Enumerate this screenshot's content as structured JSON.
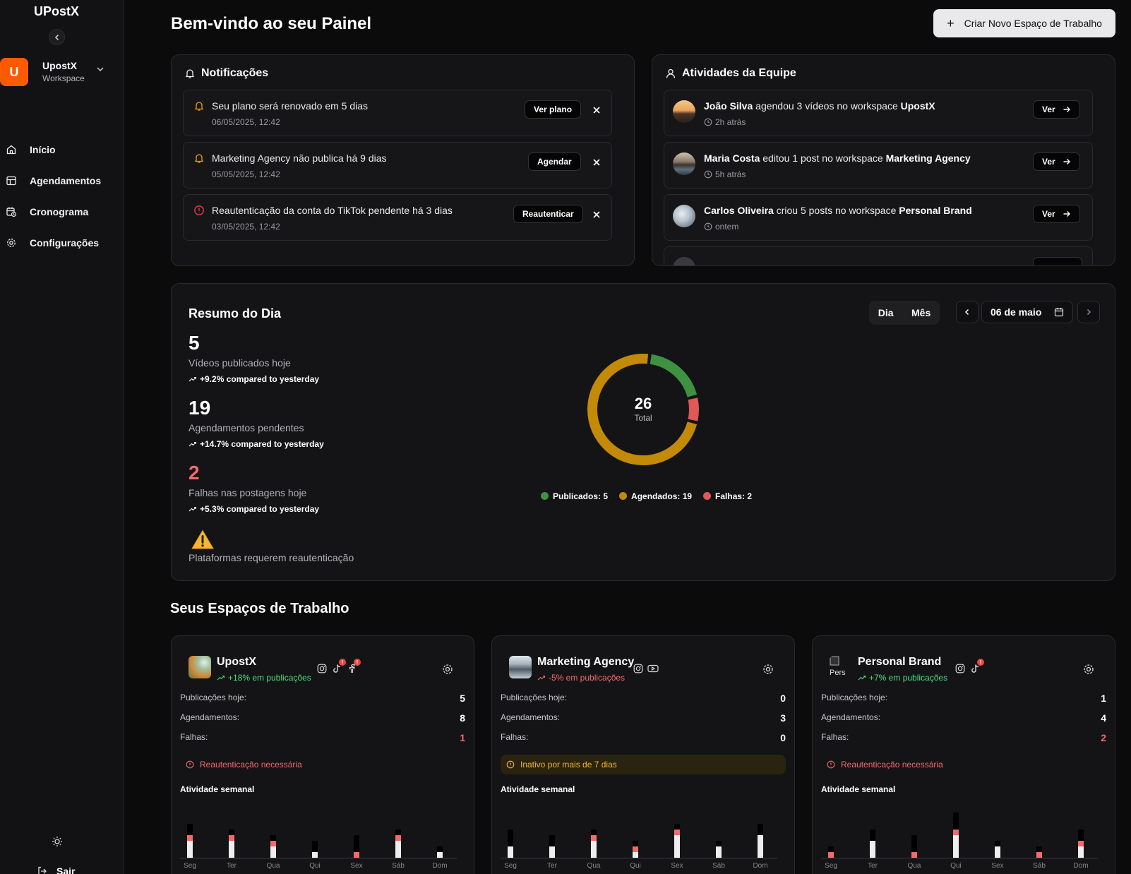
{
  "sidebar": {
    "brand": "UPostX",
    "workspace": {
      "initial": "U",
      "name": "UpostX",
      "sub": "Workspace"
    },
    "items": [
      {
        "label": "Início",
        "icon": "home-icon"
      },
      {
        "label": "Agendamentos",
        "icon": "layout-icon"
      },
      {
        "label": "Cronograma",
        "icon": "calendar-clock-icon"
      },
      {
        "label": "Configurações",
        "icon": "gear-icon"
      }
    ],
    "logout_label": "Sair"
  },
  "header": {
    "title": "Bem-vindo ao seu Painel",
    "new_workspace_label": "Criar Novo Espaço de Trabalho"
  },
  "notifications": {
    "title": "Notificações",
    "items": [
      {
        "text": "Seu plano será renovado em 5 dias",
        "date": "06/05/2025, 12:42",
        "action": "Ver plano",
        "type": "bell",
        "color": "#f59e0b"
      },
      {
        "text": "Marketing Agency não publica há 9 dias",
        "date": "05/05/2025, 12:42",
        "action": "Agendar",
        "type": "bell",
        "color": "#f59e0b"
      },
      {
        "text": "Reautenticação da conta do TikTok pendente há 3 dias",
        "date": "03/05/2025, 12:42",
        "action": "Reautenticar",
        "type": "alert",
        "color": "#ef4444"
      }
    ]
  },
  "team": {
    "title": "Atividades da Equipe",
    "items": [
      {
        "user": "João Silva",
        "action": " agendou 3 vídeos no workspace ",
        "workspace": "UpostX",
        "time": "2h atrás",
        "button": "Ver"
      },
      {
        "user": "Maria Costa",
        "action": " editou 1 post no workspace ",
        "workspace": "Marketing Agency",
        "time": "5h atrás",
        "button": "Ver"
      },
      {
        "user": "Carlos Oliveira",
        "action": " criou 5 posts no workspace ",
        "workspace": "Personal Brand",
        "time": "ontem",
        "button": "Ver"
      }
    ]
  },
  "summary": {
    "title": "Resumo do Dia",
    "tabs": [
      "Dia",
      "Mês"
    ],
    "date": "06 de maio",
    "stats": [
      {
        "value": "5",
        "label": "Vídeos publicados hoje",
        "delta": "+9.2% compared to yesterday",
        "color": "#ffffff"
      },
      {
        "value": "19",
        "label": "Agendamentos pendentes",
        "delta": "+14.7% compared to yesterday",
        "color": "#ffffff"
      },
      {
        "value": "2",
        "label": "Falhas nas postagens hoje",
        "delta": "+5.3% compared to yesterday",
        "color": "#f26b6b"
      }
    ],
    "warning_label": "Plataformas requerem reautenticação"
  },
  "chart_data": {
    "type": "pie",
    "center_value": "26",
    "center_label": "Total",
    "slices": [
      {
        "name": "Publicados",
        "value": 5,
        "color": "#3f9142"
      },
      {
        "name": "Falhas",
        "value": 2,
        "color": "#e05858"
      },
      {
        "name": "Agendados",
        "value": 19,
        "color": "#c28a06"
      }
    ],
    "legend": [
      {
        "label": "Publicados: 5",
        "color": "#3f9142"
      },
      {
        "label": "Agendados: 19",
        "color": "#c28a06"
      },
      {
        "label": "Falhas: 2",
        "color": "#e05858"
      }
    ]
  },
  "workspaces": {
    "title": "Seus Espaços de Trabalho",
    "labels": {
      "posts_today": "Publicações hoje:",
      "schedules": "Agendamentos:",
      "failures": "Falhas:",
      "weekly": "Atividade semanal"
    },
    "days": [
      "Seg",
      "Ter",
      "Qua",
      "Qui",
      "Sex",
      "Sáb",
      "Dom"
    ],
    "items": [
      {
        "name": "UpostX",
        "growth": "+18% em publicações",
        "growth_color": "#4ade80",
        "posts_today": "5",
        "schedules": "8",
        "failures": "1",
        "failures_color": "#f26b6b",
        "alert": "Reautenticação necessária",
        "alert_kind": "error",
        "socials": [
          {
            "icon": "instagram-icon",
            "badge": false
          },
          {
            "icon": "tiktok-icon",
            "badge": true
          },
          {
            "icon": "facebook-icon",
            "badge": true
          }
        ],
        "week": [
          [
            60,
            10,
            30
          ],
          [
            50,
            10,
            30
          ],
          [
            40,
            10,
            20
          ],
          [
            30,
            0,
            10
          ],
          [
            40,
            10,
            0
          ],
          [
            50,
            10,
            30
          ],
          [
            20,
            0,
            10
          ]
        ]
      },
      {
        "name": "Marketing Agency",
        "growth": "-5% em publicações",
        "growth_color": "#f26b6b",
        "posts_today": "0",
        "schedules": "3",
        "failures": "0",
        "failures_color": "#ffffff",
        "alert": "Inativo por mais de 7 dias",
        "alert_kind": "warning",
        "socials": [
          {
            "icon": "instagram-icon",
            "badge": false
          },
          {
            "icon": "youtube-icon",
            "badge": false
          }
        ],
        "week": [
          [
            50,
            0,
            20
          ],
          [
            40,
            0,
            20
          ],
          [
            50,
            10,
            30
          ],
          [
            30,
            10,
            10
          ],
          [
            60,
            10,
            40
          ],
          [
            30,
            0,
            20
          ],
          [
            60,
            0,
            40
          ]
        ]
      },
      {
        "name": "Personal Brand",
        "thumb_alt": "Pers",
        "growth": "+7% em publicações",
        "growth_color": "#4ade80",
        "posts_today": "1",
        "schedules": "4",
        "failures": "2",
        "failures_color": "#f26b6b",
        "alert": "Reautenticação necessária",
        "alert_kind": "error",
        "socials": [
          {
            "icon": "instagram-icon",
            "badge": false
          },
          {
            "icon": "tiktok-icon",
            "badge": true
          }
        ],
        "week": [
          [
            20,
            10,
            0
          ],
          [
            50,
            0,
            30
          ],
          [
            40,
            10,
            0
          ],
          [
            80,
            10,
            40
          ],
          [
            30,
            0,
            20
          ],
          [
            20,
            10,
            0
          ],
          [
            50,
            10,
            20
          ]
        ]
      }
    ]
  }
}
